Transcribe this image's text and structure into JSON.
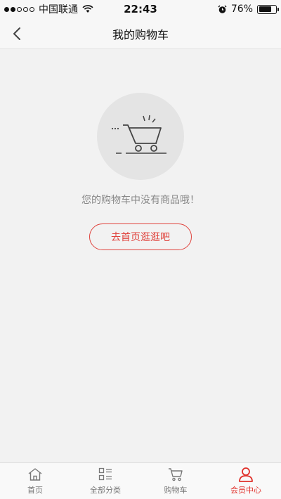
{
  "status_bar": {
    "carrier": "中国联通",
    "time": "22:43",
    "battery_percent": "76%",
    "battery_level": 0.76
  },
  "nav": {
    "title": "我的购物车",
    "back_icon": "chevron-left-icon"
  },
  "empty_state": {
    "icon": "cart-icon",
    "message": "您的购物车中没有商品哦！",
    "action_label": "去首页逛逛吧"
  },
  "tabs": [
    {
      "label": "首页",
      "icon": "home-icon",
      "active": false
    },
    {
      "label": "全部分类",
      "icon": "category-list-icon",
      "active": false
    },
    {
      "label": "购物车",
      "icon": "cart-icon",
      "active": false
    },
    {
      "label": "会员中心",
      "icon": "user-icon",
      "active": true
    }
  ],
  "colors": {
    "accent": "#e0302a",
    "button_border": "#e0443e",
    "background": "#f2f2f2"
  }
}
